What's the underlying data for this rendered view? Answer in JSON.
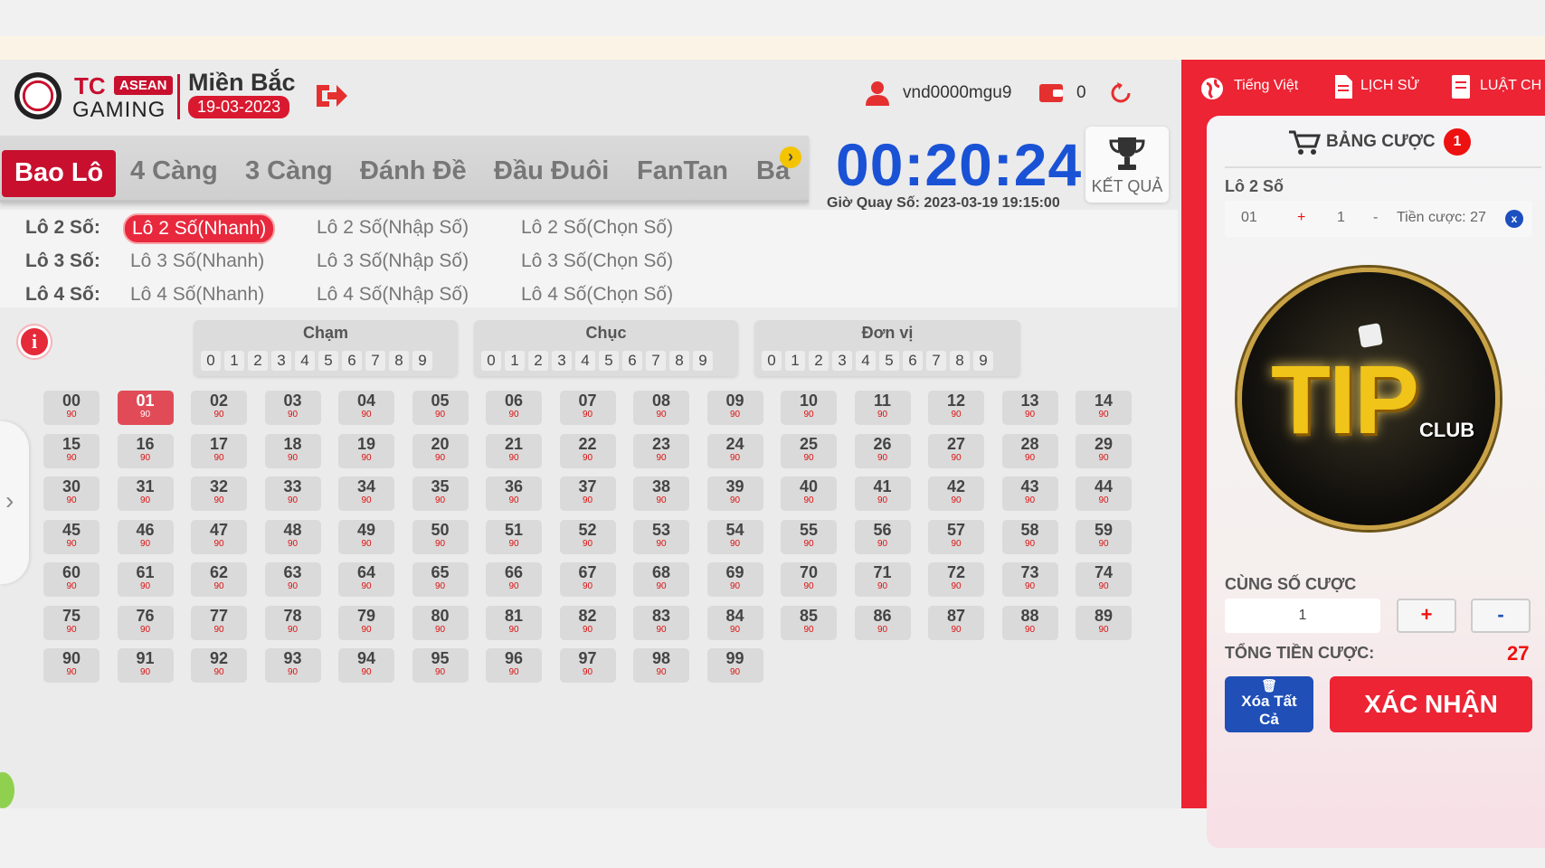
{
  "brand": {
    "tc": "TC",
    "asean": "ASEAN",
    "gaming": "GAMING",
    "region": "Miền Bắc",
    "date": "19-03-2023"
  },
  "user": {
    "username": "vnd0000mgu9",
    "balance": "0"
  },
  "tabs": [
    "Bao Lô",
    "4 Càng",
    "3 Càng",
    "Đánh Đề",
    "Đầu Đuôi",
    "FanTan",
    "Bả"
  ],
  "timer": {
    "countdown": "00:20:24",
    "draw_time": "Giờ Quay Số: 2023-03-19 19:15:00",
    "result_label": "KẾT QUẢ"
  },
  "options": {
    "rows": [
      {
        "label": "Lô 2 Số:",
        "items": [
          "Lô 2 Số(Nhanh)",
          "Lô 2 Số(Nhập Số)",
          "Lô 2 Số(Chọn Số)"
        ]
      },
      {
        "label": "Lô 3 Số:",
        "items": [
          "Lô 3 Số(Nhanh)",
          "Lô 3 Số(Nhập Số)",
          "Lô 3 Số(Chọn Số)"
        ]
      },
      {
        "label": "Lô 4 Số:",
        "items": [
          "Lô 4 Số(Nhanh)",
          "Lô 4 Số(Nhập Số)",
          "Lô 4 Số(Chọn Số)"
        ]
      }
    ],
    "selected": "Lô 2 Số(Nhanh)"
  },
  "groups": [
    {
      "title": "Chạm",
      "digits": [
        "0",
        "1",
        "2",
        "3",
        "4",
        "5",
        "6",
        "7",
        "8",
        "9"
      ]
    },
    {
      "title": "Chục",
      "digits": [
        "0",
        "1",
        "2",
        "3",
        "4",
        "5",
        "6",
        "7",
        "8",
        "9"
      ]
    },
    {
      "title": "Đơn vị",
      "digits": [
        "0",
        "1",
        "2",
        "3",
        "4",
        "5",
        "6",
        "7",
        "8",
        "9"
      ]
    }
  ],
  "numbers": {
    "odds": "90",
    "selected": "01",
    "count": 100
  },
  "info_icon": "i",
  "right": {
    "language": "Tiếng Việt",
    "history": "LỊCH SỬ",
    "rules": "LUẬT CH",
    "cart_title": "BẢNG CƯỢC",
    "cart_count": "1",
    "bet_category": "Lô 2 Số",
    "bet": {
      "number": "01",
      "plus": "+",
      "qty": "1",
      "minus": "-",
      "amount": "Tiền cược: 27",
      "remove": "x"
    },
    "banner": {
      "tip": "TIP",
      "club": "CLUB"
    },
    "same_label": "CÙNG SỐ CƯỢC",
    "same_qty": "1",
    "plus": "+",
    "minus": "-",
    "total_label": "TỔNG TIỀN CƯỢC:",
    "total_value": "27",
    "clear_label": "Xóa Tất Cả",
    "confirm_label": "XÁC NHẬN"
  },
  "colors": {
    "accent": "#c8102e",
    "timer": "#1a52d6",
    "panel": "#ec2434",
    "clear": "#1f4fb7"
  }
}
